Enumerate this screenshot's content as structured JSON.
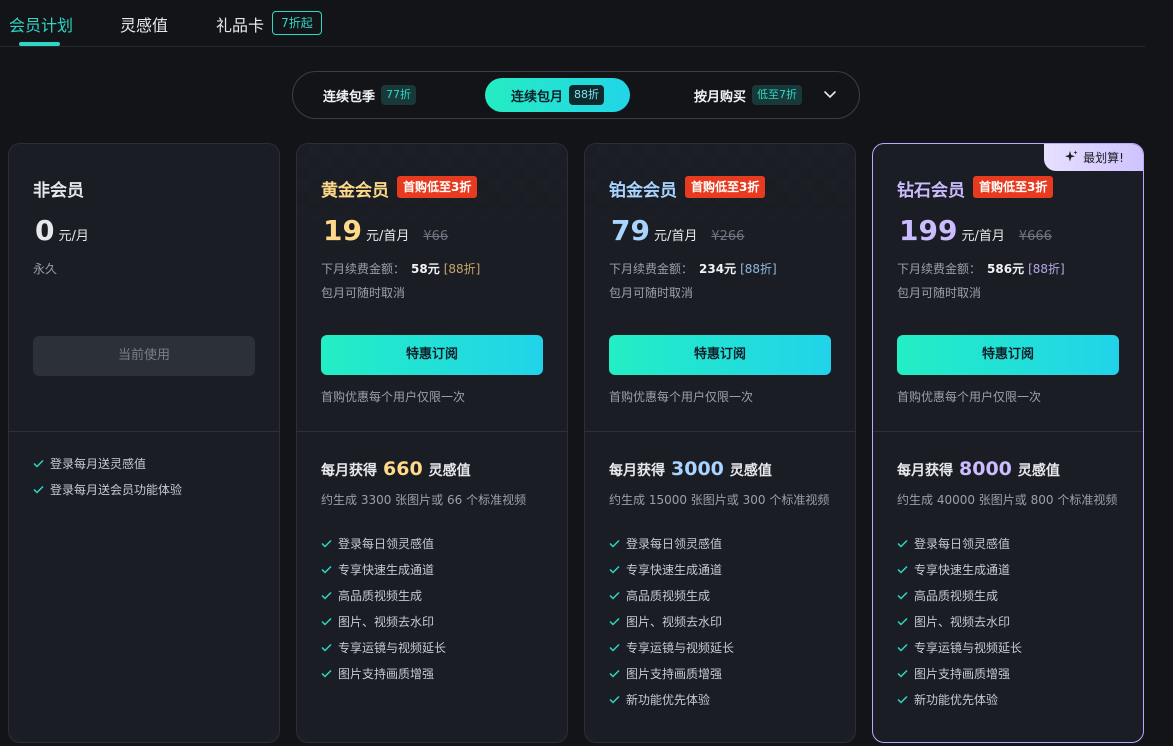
{
  "tabs": [
    {
      "label": "会员计划"
    },
    {
      "label": "灵感值"
    },
    {
      "label": "礼品卡",
      "badge": "7折起"
    }
  ],
  "billing": {
    "options": [
      {
        "label": "连续包季",
        "tag": "77折"
      },
      {
        "label": "连续包月",
        "tag": "88折"
      },
      {
        "label": "按月购买",
        "tag": "低至7折"
      }
    ],
    "selected": "连续包月"
  },
  "plans": [
    {
      "name": "非会员",
      "price": "0",
      "unit": "元/月",
      "duration": "永久",
      "button": "当前使用",
      "features": [
        "登录每月送灵感值",
        "登录每月送会员功能体验"
      ]
    },
    {
      "name": "黄金会员",
      "promo": "首购低至3折",
      "price": "19",
      "unit": "元/首月",
      "original": "¥66",
      "renew_label": "下月续费金额：",
      "renew_price": "58元",
      "renew_discount": "[88折]",
      "cancel_note": "包月可随时取消",
      "button": "特惠订阅",
      "note": "首购优惠每个用户仅限一次",
      "credits_prefix": "每月获得",
      "credits": "660",
      "credits_suffix": "灵感值",
      "generate": "约生成 3300 张图片或 66 个标准视频",
      "features": [
        "登录每日领灵感值",
        "专享快速生成通道",
        "高品质视频生成",
        "图片、视频去水印",
        "专享运镜与视频延长",
        "图片支持画质增强"
      ]
    },
    {
      "name": "铂金会员",
      "promo": "首购低至3折",
      "price": "79",
      "unit": "元/首月",
      "original": "¥266",
      "renew_label": "下月续费金额：",
      "renew_price": "234元",
      "renew_discount": "[88折]",
      "cancel_note": "包月可随时取消",
      "button": "特惠订阅",
      "note": "首购优惠每个用户仅限一次",
      "credits_prefix": "每月获得",
      "credits": "3000",
      "credits_suffix": "灵感值",
      "generate": "约生成 15000 张图片或 300 个标准视频",
      "features": [
        "登录每日领灵感值",
        "专享快速生成通道",
        "高品质视频生成",
        "图片、视频去水印",
        "专享运镜与视频延长",
        "图片支持画质增强",
        "新功能优先体验"
      ]
    },
    {
      "name": "钻石会员",
      "promo": "首购低至3折",
      "best_badge": "最划算!",
      "price": "199",
      "unit": "元/首月",
      "original": "¥666",
      "renew_label": "下月续费金额：",
      "renew_price": "586元",
      "renew_discount": "[88折]",
      "cancel_note": "包月可随时取消",
      "button": "特惠订阅",
      "note": "首购优惠每个用户仅限一次",
      "credits_prefix": "每月获得",
      "credits": "8000",
      "credits_suffix": "灵感值",
      "generate": "约生成 40000 张图片或 800 个标准视频",
      "features": [
        "登录每日领灵感值",
        "专享快速生成通道",
        "高品质视频生成",
        "图片、视频去水印",
        "专享运镜与视频延长",
        "图片支持画质增强",
        "新功能优先体验"
      ]
    }
  ],
  "colors": {
    "accent": "#2ed6c4",
    "gold": "#ffd98a",
    "platinum": "#a9d4ff",
    "diamond": "#cbbcff",
    "promo": "#e83a1e"
  }
}
